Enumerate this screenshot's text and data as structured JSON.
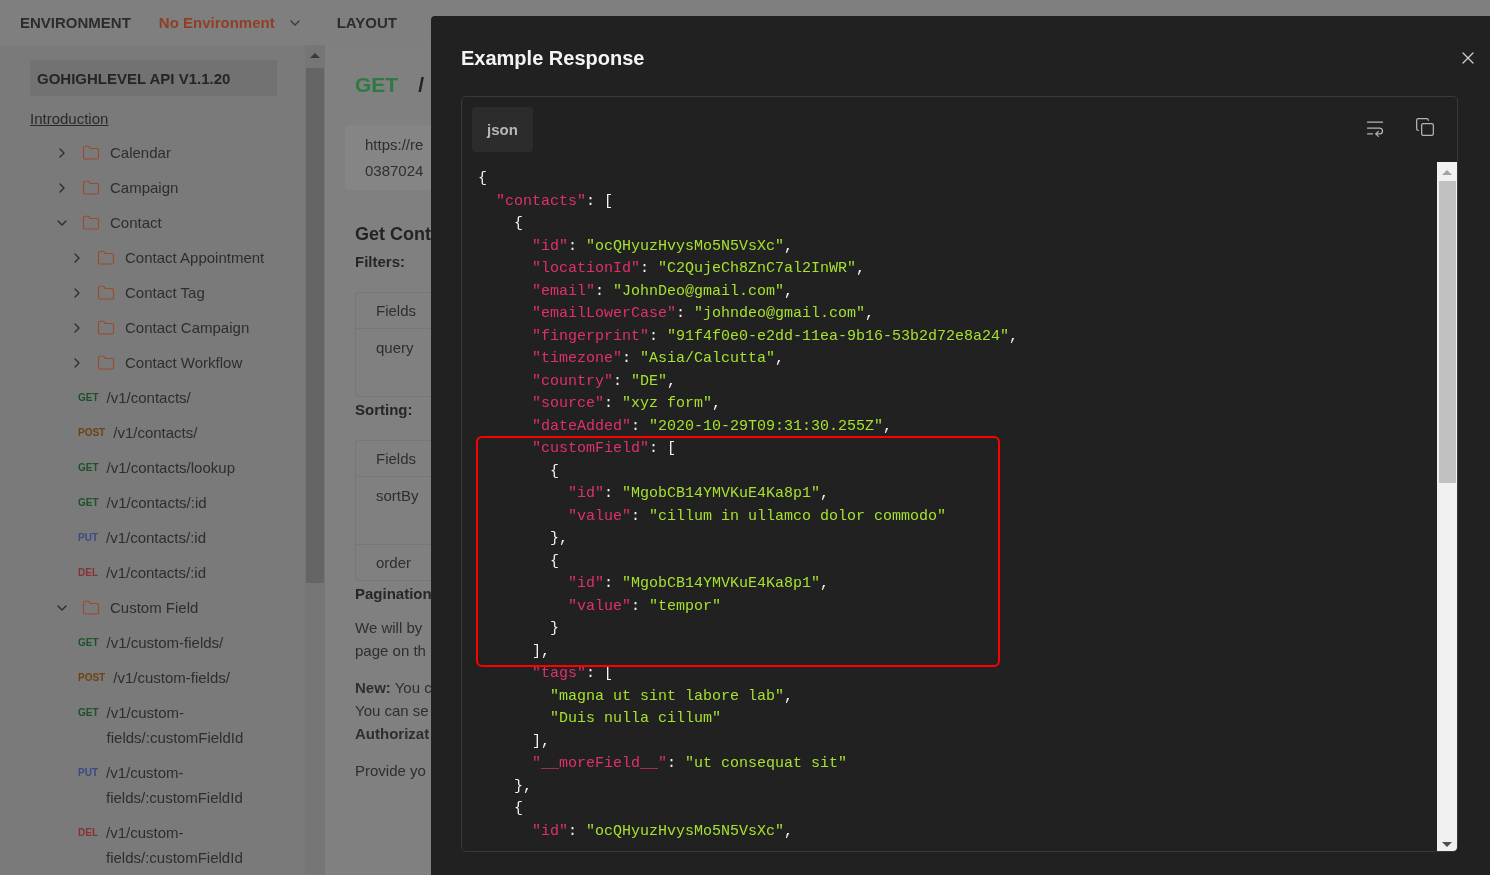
{
  "top_bar": {
    "environment_label": "ENVIRONMENT",
    "environment_value": "No Environment",
    "layout_label": "LAYOUT"
  },
  "sidebar": {
    "title": "GOHIGHLEVEL API V1.1.20",
    "intro_link": "Introduction",
    "items": [
      {
        "kind": "folder",
        "label": "Calendar",
        "expanded": false
      },
      {
        "kind": "folder",
        "label": "Campaign",
        "expanded": false
      },
      {
        "kind": "folder",
        "label": "Contact",
        "expanded": true,
        "children": [
          {
            "kind": "folder",
            "label": "Contact Appointment",
            "expanded": false
          },
          {
            "kind": "folder",
            "label": "Contact Tag",
            "expanded": false
          },
          {
            "kind": "folder",
            "label": "Contact Campaign",
            "expanded": false
          },
          {
            "kind": "folder",
            "label": "Contact Workflow",
            "expanded": false
          },
          {
            "kind": "endpoint",
            "method": "GET",
            "color": "#1d5229",
            "label": "/v1/contacts/"
          },
          {
            "kind": "endpoint",
            "method": "POST",
            "color": "#6b4414",
            "label": "/v1/contacts/"
          },
          {
            "kind": "endpoint",
            "method": "GET",
            "color": "#1d5229",
            "label": "/v1/contacts/lookup"
          },
          {
            "kind": "endpoint",
            "method": "GET",
            "color": "#1d5229",
            "label": "/v1/contacts/:id"
          },
          {
            "kind": "endpoint",
            "method": "PUT",
            "color": "#3a4a86",
            "label": "/v1/contacts/:id"
          },
          {
            "kind": "endpoint",
            "method": "DEL",
            "color": "#8a3032",
            "label": "/v1/contacts/:id"
          }
        ]
      },
      {
        "kind": "folder",
        "label": "Custom Field",
        "expanded": true,
        "children": [
          {
            "kind": "endpoint",
            "method": "GET",
            "color": "#1d5229",
            "label": "/v1/custom-fields/"
          },
          {
            "kind": "endpoint",
            "method": "POST",
            "color": "#6b4414",
            "label": "/v1/custom-fields/"
          },
          {
            "kind": "endpoint",
            "method": "GET",
            "color": "#1d5229",
            "label": "/v1/custom-fields/:customFieldId"
          },
          {
            "kind": "endpoint",
            "method": "PUT",
            "color": "#3a4a86",
            "label": "/v1/custom-fields/:customFieldId"
          },
          {
            "kind": "endpoint",
            "method": "DEL",
            "color": "#8a3032",
            "label": "/v1/custom-fields/:customFieldId"
          }
        ]
      }
    ]
  },
  "content": {
    "method": "GET",
    "path": "/",
    "url_lines": [
      "https://re",
      "0387024"
    ],
    "heading": "Get Cont",
    "filters_label": "Filters:",
    "filters_table": [
      "Fields",
      "query"
    ],
    "sorting_label": "Sorting:",
    "sorting_table": [
      "Fields",
      "sortBy",
      "order"
    ],
    "pagination_label": "Pagination",
    "paragraphs": [
      [
        "We will by",
        "page on th"
      ],
      [
        "**New:** You c",
        "You can se",
        "**Authorizat**"
      ],
      [
        "Provide yo"
      ]
    ]
  },
  "modal": {
    "title": "Example Response",
    "language_tab": "json",
    "code_blocks": [
      {
        "kind": "plain",
        "lines": [
          [
            {
              "kind": "punct",
              "text": "{"
            }
          ],
          [
            {
              "kind": "key",
              "text": "  \"contacts\""
            },
            {
              "kind": "punct",
              "text": ": ["
            }
          ],
          [
            {
              "kind": "punct",
              "text": "    {"
            }
          ],
          [
            {
              "kind": "key",
              "text": "      \"id\""
            },
            {
              "kind": "punct",
              "text": ": "
            },
            {
              "kind": "string",
              "text": "\"ocQHyuzHvysMo5N5VsXc\""
            },
            {
              "kind": "punct",
              "text": ","
            }
          ],
          [
            {
              "kind": "key",
              "text": "      \"locationId\""
            },
            {
              "kind": "punct",
              "text": ": "
            },
            {
              "kind": "string",
              "text": "\"C2QujeCh8ZnC7al2InWR\""
            },
            {
              "kind": "punct",
              "text": ","
            }
          ],
          [
            {
              "kind": "key",
              "text": "      \"email\""
            },
            {
              "kind": "punct",
              "text": ": "
            },
            {
              "kind": "string",
              "text": "\"JohnDeo@gmail.com\""
            },
            {
              "kind": "punct",
              "text": ","
            }
          ],
          [
            {
              "kind": "key",
              "text": "      \"emailLowerCase\""
            },
            {
              "kind": "punct",
              "text": ": "
            },
            {
              "kind": "string",
              "text": "\"johndeo@gmail.com\""
            },
            {
              "kind": "punct",
              "text": ","
            }
          ],
          [
            {
              "kind": "key",
              "text": "      \"fingerprint\""
            },
            {
              "kind": "punct",
              "text": ": "
            },
            {
              "kind": "string",
              "text": "\"91f4f0e0-e2dd-11ea-9b16-53b2d72e8a24\""
            },
            {
              "kind": "punct",
              "text": ","
            }
          ],
          [
            {
              "kind": "key",
              "text": "      \"timezone\""
            },
            {
              "kind": "punct",
              "text": ": "
            },
            {
              "kind": "string",
              "text": "\"Asia/Calcutta\""
            },
            {
              "kind": "punct",
              "text": ","
            }
          ],
          [
            {
              "kind": "key",
              "text": "      \"country\""
            },
            {
              "kind": "punct",
              "text": ": "
            },
            {
              "kind": "string",
              "text": "\"DE\""
            },
            {
              "kind": "punct",
              "text": ","
            }
          ],
          [
            {
              "kind": "key",
              "text": "      \"source\""
            },
            {
              "kind": "punct",
              "text": ": "
            },
            {
              "kind": "string",
              "text": "\"xyz form\""
            },
            {
              "kind": "punct",
              "text": ","
            }
          ],
          [
            {
              "kind": "key",
              "text": "      \"dateAdded\""
            },
            {
              "kind": "punct",
              "text": ": "
            },
            {
              "kind": "string",
              "text": "\"2020-10-29T09:31:30.255Z\""
            },
            {
              "kind": "punct",
              "text": ","
            }
          ]
        ]
      },
      {
        "kind": "highlight",
        "lines": [
          [
            {
              "kind": "key",
              "text": "      \"customField\""
            },
            {
              "kind": "punct",
              "text": ": ["
            }
          ],
          [
            {
              "kind": "punct",
              "text": "        {"
            }
          ],
          [
            {
              "kind": "key",
              "text": "          \"id\""
            },
            {
              "kind": "punct",
              "text": ": "
            },
            {
              "kind": "string",
              "text": "\"MgobCB14YMVKuE4Ka8p1\""
            },
            {
              "kind": "punct",
              "text": ","
            }
          ],
          [
            {
              "kind": "key",
              "text": "          \"value\""
            },
            {
              "kind": "punct",
              "text": ": "
            },
            {
              "kind": "string",
              "text": "\"cillum in ullamco dolor commodo\""
            }
          ],
          [
            {
              "kind": "punct",
              "text": "        },"
            }
          ],
          [
            {
              "kind": "punct",
              "text": "        {"
            }
          ],
          [
            {
              "kind": "key",
              "text": "          \"id\""
            },
            {
              "kind": "punct",
              "text": ": "
            },
            {
              "kind": "string",
              "text": "\"MgobCB14YMVKuE4Ka8p1\""
            },
            {
              "kind": "punct",
              "text": ","
            }
          ],
          [
            {
              "kind": "key",
              "text": "          \"value\""
            },
            {
              "kind": "punct",
              "text": ": "
            },
            {
              "kind": "string",
              "text": "\"tempor\""
            }
          ],
          [
            {
              "kind": "punct",
              "text": "        }"
            }
          ],
          [
            {
              "kind": "punct",
              "text": "      ],"
            }
          ]
        ]
      },
      {
        "kind": "plain",
        "lines": [
          [
            {
              "kind": "key",
              "text": "      \"tags\""
            },
            {
              "kind": "punct",
              "text": ": ["
            }
          ],
          [
            {
              "kind": "string",
              "text": "        \"magna ut sint labore lab\""
            },
            {
              "kind": "punct",
              "text": ","
            }
          ],
          [
            {
              "kind": "string",
              "text": "        \"Duis nulla cillum\""
            }
          ],
          [
            {
              "kind": "punct",
              "text": "      ],"
            }
          ],
          [
            {
              "kind": "key",
              "text": "      \"__moreField__\""
            },
            {
              "kind": "punct",
              "text": ": "
            },
            {
              "kind": "string",
              "text": "\"ut consequat sit\""
            }
          ],
          [
            {
              "kind": "punct",
              "text": "    },"
            }
          ],
          [
            {
              "kind": "punct",
              "text": "    {"
            }
          ],
          [
            {
              "kind": "key",
              "text": "      \"id\""
            },
            {
              "kind": "punct",
              "text": ": "
            },
            {
              "kind": "string",
              "text": "\"ocQHyuzHvysMo5N5VsXc\""
            },
            {
              "kind": "punct",
              "text": ","
            }
          ]
        ]
      }
    ]
  }
}
